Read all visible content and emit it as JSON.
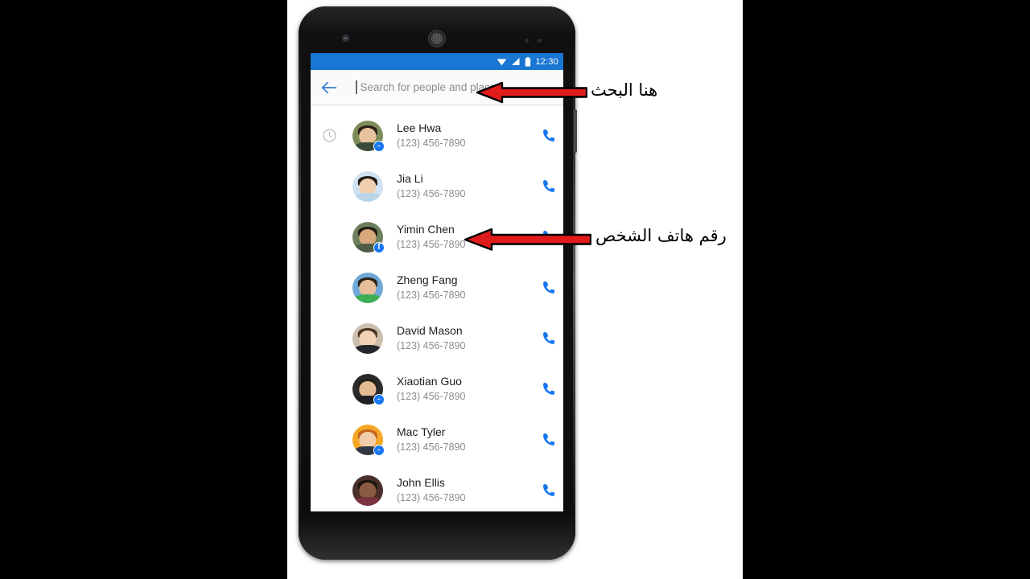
{
  "screen": {
    "statusbar": {
      "time": "12:30",
      "icons": [
        "wifi-icon",
        "cellular-signal-icon",
        "battery-icon"
      ]
    },
    "searchbar": {
      "back_icon": "back-arrow-icon",
      "placeholder": "Search for people and places",
      "value": ""
    },
    "list": {
      "lead_icon_first_row": "history-clock-icon",
      "call_icon": "phone-call-icon",
      "contacts": [
        {
          "name": "Lee Hwa",
          "phone": "(123) 456-7890",
          "badge": "messenger",
          "avatar_bg": "#7e8c5a",
          "lead_icon": true
        },
        {
          "name": "Jia Li",
          "phone": "(123) 456-7890",
          "badge": "none",
          "avatar_bg": "#cfe2f2",
          "lead_icon": false
        },
        {
          "name": "Yimin Chen",
          "phone": "(123) 456-7890",
          "badge": "facebook",
          "avatar_bg": "#6d7f5c",
          "lead_icon": false
        },
        {
          "name": "Zheng Fang",
          "phone": "(123) 456-7890",
          "badge": "none",
          "avatar_bg": "#6fa8d6",
          "lead_icon": false
        },
        {
          "name": "David Mason",
          "phone": "(123) 456-7890",
          "badge": "none",
          "avatar_bg": "#cdbfae",
          "lead_icon": false
        },
        {
          "name": "Xiaotian Guo",
          "phone": "(123) 456-7890",
          "badge": "messenger",
          "avatar_bg": "#2a2a2a",
          "lead_icon": false
        },
        {
          "name": "Mac Tyler",
          "phone": "(123) 456-7890",
          "badge": "messenger",
          "avatar_bg": "#f5a623",
          "lead_icon": false
        },
        {
          "name": "John Ellis",
          "phone": "(123) 456-7890",
          "badge": "none",
          "avatar_bg": "#4a2f2a",
          "lead_icon": false
        }
      ]
    }
  },
  "annotations": [
    {
      "label": "هنا البحث",
      "arrow": "left-arrow"
    },
    {
      "label": "رقم هاتف الشخص",
      "arrow": "left-arrow"
    }
  ],
  "colors": {
    "status_bar": "#1976d2",
    "accent_blue": "#1877f2",
    "arrow_red": "#e01b1b",
    "arrow_outline": "#000000",
    "name_text": "#1c1e21",
    "phone_text": "#8a8d91",
    "placeholder_text": "#8d8d8d"
  }
}
